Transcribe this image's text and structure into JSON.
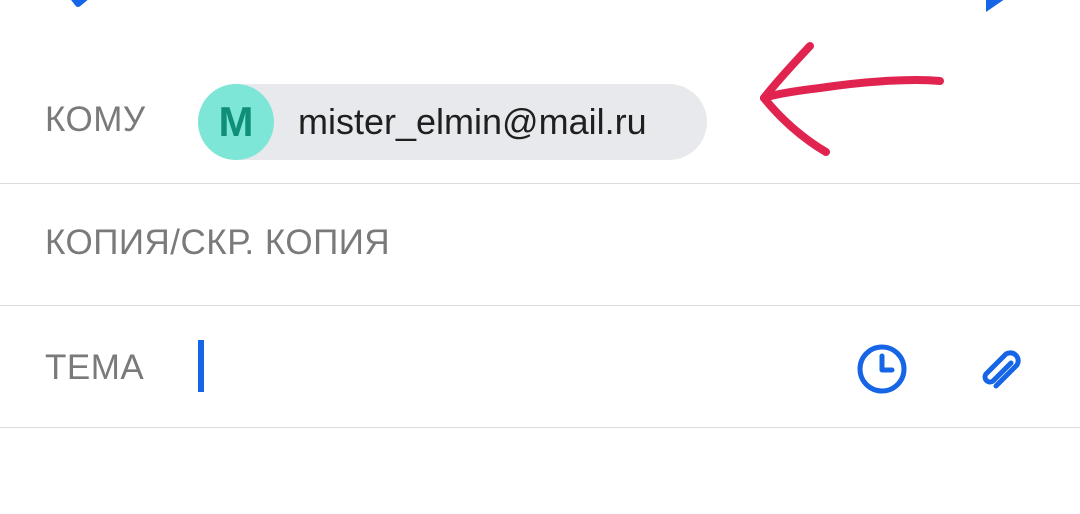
{
  "compose": {
    "to": {
      "label": "КОМУ",
      "recipient": {
        "initial": "M",
        "email": "mister_elmin@mail.ru",
        "avatar_color": "#7de6d6",
        "initial_color": "#0f8f78",
        "chip_color": "#e8e9ec"
      }
    },
    "cc": {
      "label": "КОПИЯ/СКР. КОПИЯ"
    },
    "subject": {
      "label": "ТЕМА",
      "value": ""
    }
  },
  "toolbar": {
    "back_icon": "back-arrow-icon",
    "send_icon": "send-icon"
  },
  "subject_actions": {
    "schedule_icon": "clock-icon",
    "attach_icon": "paperclip-icon"
  },
  "annotation": {
    "icon": "arrow-icon",
    "color": "#e0234f"
  },
  "colors": {
    "accent": "#1565e6",
    "label": "#7a7a7a",
    "divider": "#dcdcdc"
  }
}
